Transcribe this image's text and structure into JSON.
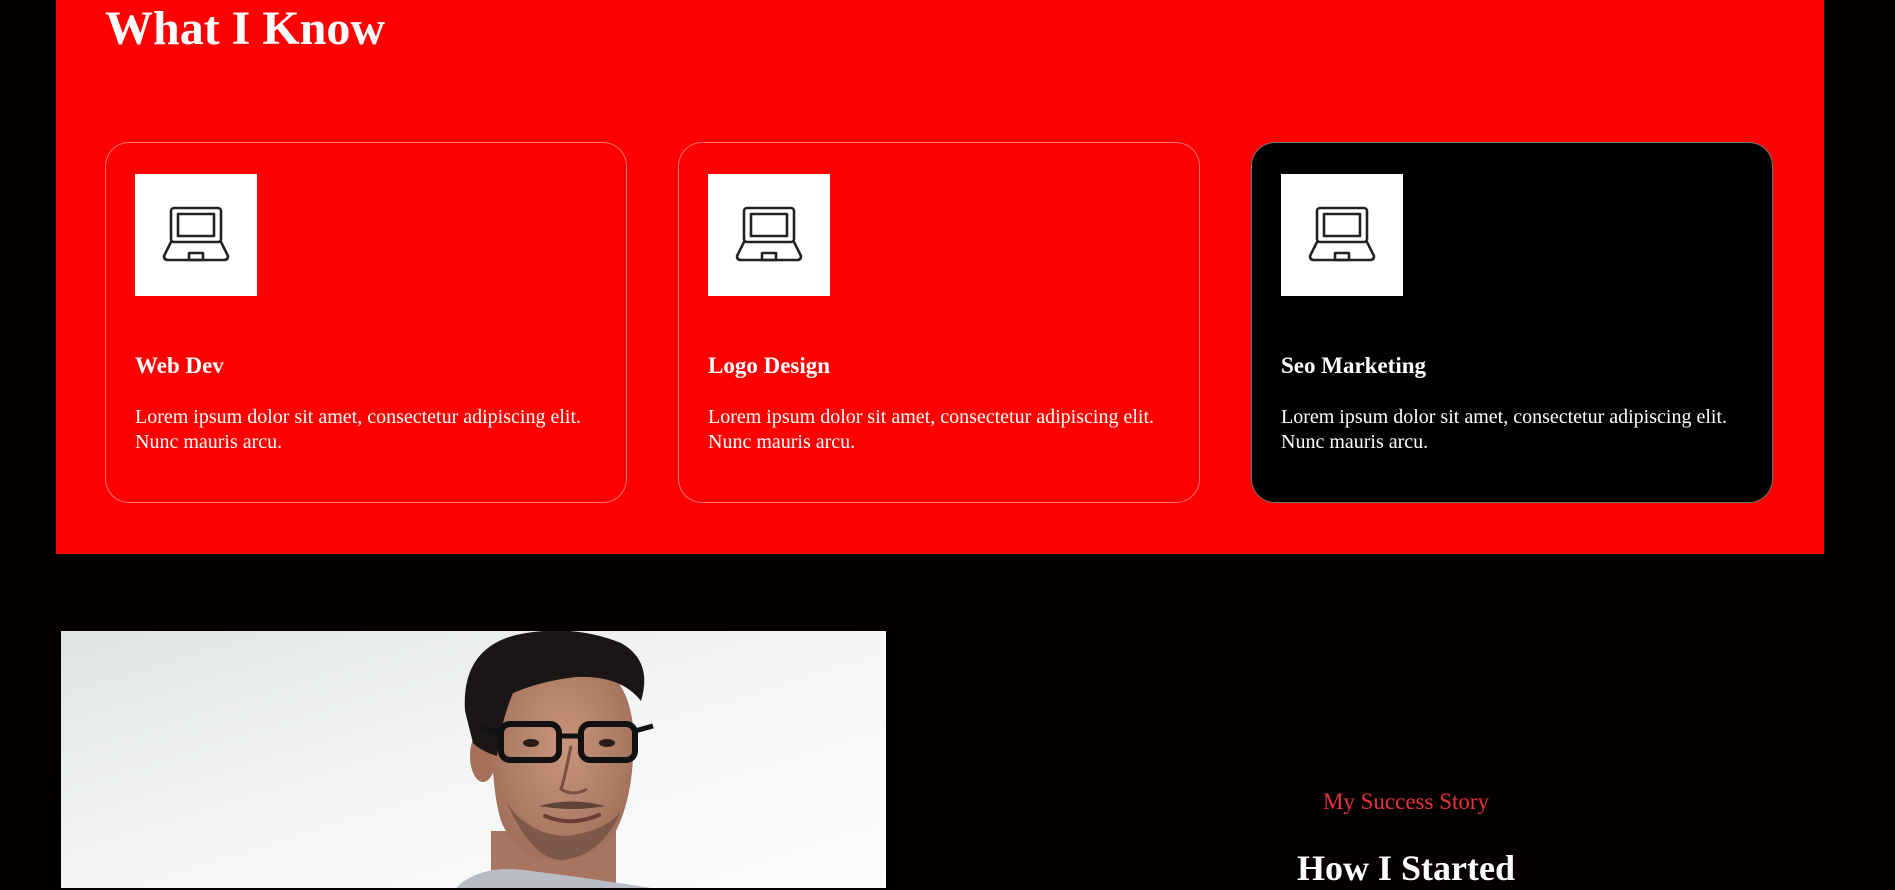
{
  "services": {
    "title": "What I Know",
    "background": "#ff0000",
    "cards": [
      {
        "title": "Web Dev",
        "text": "Lorem ipsum dolor sit amet, consectetur adipiscing elit. Nunc mauris arcu.",
        "icon": "laptop-icon"
      },
      {
        "title": "Logo Design",
        "text": "Lorem ipsum dolor sit amet, consectetur adipiscing elit. Nunc mauris arcu.",
        "icon": "laptop-icon"
      },
      {
        "title": "Seo Marketing",
        "text": "Lorem ipsum dolor sit amet, consectetur adipiscing elit. Nunc mauris arcu.",
        "icon": "laptop-icon",
        "active": true
      }
    ]
  },
  "story": {
    "eyebrow": "My Success Story",
    "title": "How I Started",
    "accent_color": "#e8323a",
    "photo": "portrait-photo"
  }
}
